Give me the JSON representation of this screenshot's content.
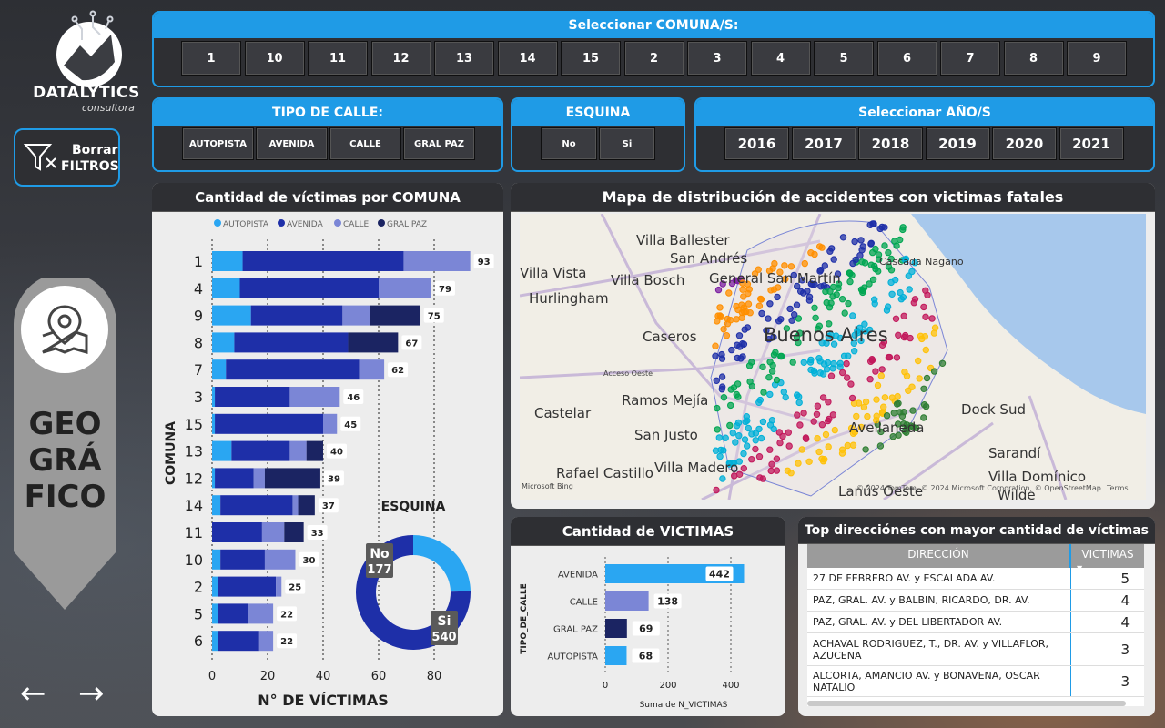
{
  "brand": {
    "name": "DATALYTICS",
    "sub": "consultora"
  },
  "clear_filters": {
    "line1": "Borrar",
    "line2": "FILTROS",
    "icon": "filter-clear-icon"
  },
  "section": {
    "lines": [
      "GEO",
      "GRÁ",
      "FICO"
    ],
    "icon": "map-pin-icon"
  },
  "nav": {
    "prev": "←",
    "next": "→"
  },
  "comuna_filter": {
    "title": "Seleccionar COMUNA/S:",
    "options": [
      "1",
      "10",
      "11",
      "12",
      "13",
      "14",
      "15",
      "2",
      "3",
      "4",
      "5",
      "6",
      "7",
      "8",
      "9"
    ]
  },
  "calle_filter": {
    "title": "TIPO DE CALLE:",
    "options": [
      "AUTOPISTA",
      "AVENIDA",
      "CALLE",
      "GRAL PAZ"
    ]
  },
  "esquina_filter": {
    "title": "ESQUINA",
    "options": [
      "No",
      "Si"
    ]
  },
  "anio_filter": {
    "title": "Seleccionar AÑO/S",
    "options": [
      "2016",
      "2017",
      "2018",
      "2019",
      "2020",
      "2021"
    ]
  },
  "colors": {
    "accent": "#1f9be6",
    "autopista": "#2aa6f2",
    "avenida": "#1e2fa8",
    "calle": "#7b86d6",
    "gral_paz": "#1b2462"
  },
  "chart_data": [
    {
      "type": "bar",
      "title": "Cantidad de víctimas por COMUNA",
      "xlabel": "N° DE VÍCTIMAS",
      "ylabel": "COMUNA",
      "legend": [
        "AUTOPISTA",
        "AVENIDA",
        "CALLE",
        "GRAL PAZ"
      ],
      "legend_position": "top",
      "xlim": [
        0,
        95
      ],
      "xticks": [
        0,
        20,
        40,
        60,
        80
      ],
      "categories": [
        "1",
        "4",
        "9",
        "8",
        "7",
        "3",
        "15",
        "13",
        "12",
        "14",
        "11",
        "10",
        "2",
        "5",
        "6"
      ],
      "totals": [
        93,
        79,
        75,
        67,
        62,
        46,
        45,
        40,
        39,
        37,
        33,
        30,
        25,
        22,
        22
      ],
      "series": [
        {
          "name": "AUTOPISTA",
          "values": [
            11,
            10,
            14,
            8,
            5,
            1,
            1,
            7,
            1,
            3,
            0,
            3,
            2,
            2,
            2
          ]
        },
        {
          "name": "AVENIDA",
          "values": [
            58,
            50,
            33,
            41,
            48,
            27,
            39,
            21,
            14,
            26,
            18,
            16,
            21,
            11,
            15
          ]
        },
        {
          "name": "CALLE",
          "values": [
            24,
            19,
            10,
            0,
            9,
            18,
            5,
            6,
            4,
            2,
            8,
            11,
            2,
            9,
            5
          ]
        },
        {
          "name": "GRAL PAZ",
          "values": [
            0,
            0,
            18,
            18,
            0,
            0,
            0,
            6,
            20,
            6,
            7,
            0,
            0,
            0,
            0
          ]
        }
      ]
    },
    {
      "type": "pie",
      "title": "ESQUINA",
      "categories": [
        "No",
        "Si"
      ],
      "values": [
        177,
        540
      ]
    },
    {
      "type": "bar",
      "title": "Cantidad de VICTIMAS",
      "ylabel": "TIPO_DE_CALLE",
      "xlabel": "Suma de N_VICTIMAS",
      "xlim": [
        0,
        460
      ],
      "xticks": [
        0,
        200,
        400
      ],
      "categories": [
        "AVENIDA",
        "CALLE",
        "GRAL PAZ",
        "AUTOPISTA"
      ],
      "values": [
        442,
        138,
        69,
        68
      ]
    }
  ],
  "map": {
    "title": "Mapa de distribución de accidentes con victimas fatales",
    "labels": [
      "Villa Ballester",
      "San Andrés",
      "Villa Vista",
      "Villa Bosch",
      "General San Martín",
      "Hurlingham",
      "Caseros",
      "Buenos Aires",
      "Cascada Nagano",
      "Ramos Mejía",
      "Castelar",
      "San Justo",
      "Avellaneda",
      "Dock Sud",
      "Sarandí",
      "Rafael Castillo",
      "Villa Madero",
      "Villa Domínico",
      "Lanús Oeste",
      "Wilde",
      "Acceso Oeste"
    ],
    "attribution": "© 2024 TomTom, © 2024 Microsoft Corporation, © OpenStreetMap",
    "terms": "Terms",
    "logo": "Microsoft Bing"
  },
  "top_table": {
    "title": "Top direcciónes con mayor cantidad de víctimas",
    "columns": [
      "DIRECCIÓN",
      "VICTIMAS"
    ],
    "rows": [
      {
        "dir": "27 DE FEBRERO AV. y ESCALADA AV.",
        "v": "5"
      },
      {
        "dir": "PAZ, GRAL. AV. y BALBIN, RICARDO, DR. AV.",
        "v": "4"
      },
      {
        "dir": "PAZ, GRAL. AV. y DEL LIBERTADOR AV.",
        "v": "4"
      },
      {
        "dir": "ACHAVAL RODRIGUEZ, T., DR. AV. y VILLAFLOR, AZUCENA",
        "v": "3"
      },
      {
        "dir": "ALCORTA, AMANCIO AV. y BONAVENA, OSCAR NATALIO",
        "v": "3"
      }
    ]
  }
}
